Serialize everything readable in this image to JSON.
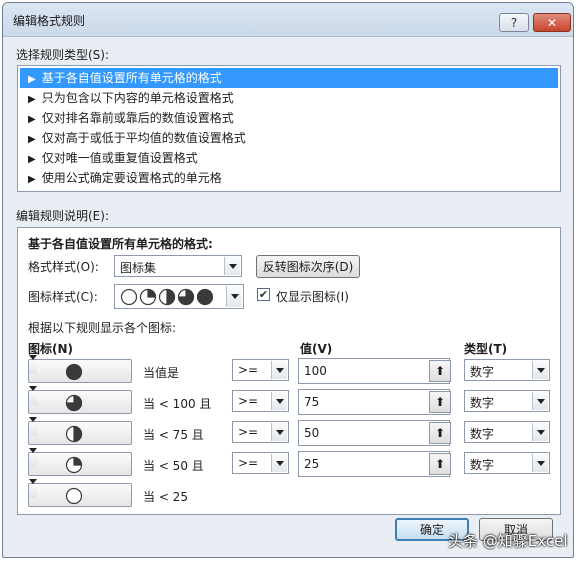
{
  "dialog": {
    "title": "编辑格式规则",
    "help_label": "?",
    "close_label": "✕"
  },
  "rule_types": {
    "label": "选择规则类型(S):",
    "items": [
      {
        "label": "基于各自值设置所有单元格的格式",
        "selected": true
      },
      {
        "label": "只为包含以下内容的单元格设置格式",
        "selected": false
      },
      {
        "label": "仅对排名靠前或靠后的数值设置格式",
        "selected": false
      },
      {
        "label": "仅对高于或低于平均值的数值设置格式",
        "selected": false
      },
      {
        "label": "仅对唯一值或重复值设置格式",
        "selected": false
      },
      {
        "label": "使用公式确定要设置格式的单元格",
        "selected": false
      }
    ]
  },
  "edit_section": {
    "label": "编辑规则说明(E):",
    "heading": "基于各自值设置所有单元格的格式:",
    "format_style_label": "格式样式(O):",
    "format_style_value": "图标集",
    "reverse_order_button": "反转图标次序(D)",
    "icon_style_label": "图标样式(C):",
    "icon_style_name": "quarters-icon-set",
    "show_icon_only_label": "仅显示图标(I)",
    "show_icon_only_checked": true,
    "rules_caption": "根据以下规则显示各个图标:",
    "col_icon": "图标(N)",
    "col_value": "值(V)",
    "col_type": "类型(T)",
    "rows": [
      {
        "icon": "full-circle-icon",
        "condition": "当值是",
        "operator": ">=",
        "value": "100",
        "type": "数字"
      },
      {
        "icon": "three-quarter-circle-icon",
        "condition": "当 < 100 且",
        "operator": ">=",
        "value": "75",
        "type": "数字"
      },
      {
        "icon": "half-circle-icon",
        "condition": "当 < 75 且",
        "operator": ">=",
        "value": "50",
        "type": "数字"
      },
      {
        "icon": "quarter-circle-icon",
        "condition": "当 < 50 且",
        "operator": ">=",
        "value": "25",
        "type": "数字"
      },
      {
        "icon": "empty-circle-icon",
        "condition": "当 < 25",
        "operator": null,
        "value": null,
        "type": null
      }
    ]
  },
  "footer": {
    "ok_button": "确定",
    "cancel_button": "取消"
  },
  "watermark": "头条 @知骤Excel",
  "colors": {
    "selection": "#3399ff",
    "dialog_bg": "#e9eef5",
    "icon_dark": "#3a3a3a"
  }
}
